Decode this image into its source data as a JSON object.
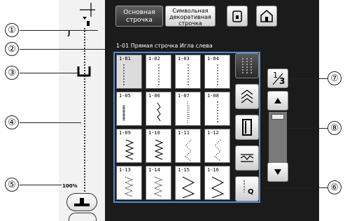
{
  "tabs": {
    "basic_line1": "Основная",
    "basic_line2": "строчка",
    "deco_line1": "Символьная",
    "deco_line2": "декоративная",
    "deco_line3": "строчка"
  },
  "info_bar": "1-01  Прямая строчка Игла слева",
  "preview": {
    "presser_foot_code": "J",
    "zoom": "100%"
  },
  "page_indicator": {
    "current": "1",
    "total": "3"
  },
  "callouts": [
    "①",
    "②",
    "③",
    "④",
    "⑤",
    "⑥",
    "⑦",
    "⑧"
  ],
  "stitches": [
    {
      "code": "1-01",
      "icon": "straight-left"
    },
    {
      "code": "1-02",
      "icon": "straight-center"
    },
    {
      "code": "1-03",
      "icon": "straight-center"
    },
    {
      "code": "1-04",
      "icon": "straight-center"
    },
    {
      "code": "1-05",
      "icon": "triple-straight-left"
    },
    {
      "code": "1-06",
      "icon": "stretch-diagonal"
    },
    {
      "code": "1-07",
      "icon": "triple-stretch"
    },
    {
      "code": "1-08",
      "icon": "straight-center"
    },
    {
      "code": "1-09",
      "icon": "zigzag"
    },
    {
      "code": "1-10",
      "icon": "zigzag"
    },
    {
      "code": "1-11",
      "icon": "dotted-zigzag"
    },
    {
      "code": "1-12",
      "icon": "dotted-zigzag"
    },
    {
      "code": "1-13",
      "icon": "multi-zigzag"
    },
    {
      "code": "1-14",
      "icon": "multi-zigzag"
    },
    {
      "code": "1-15",
      "icon": "large-zigzag"
    },
    {
      "code": "1-16",
      "icon": "large-zigzag"
    }
  ],
  "selected_stitch": "1-01",
  "category_icons": [
    "utility-stitch-icon",
    "overcast-stitch-icon",
    "buttonhole-icon",
    "decorative-stitch-icon",
    "quilting-stitch-icon"
  ],
  "quilt_label": "Q"
}
